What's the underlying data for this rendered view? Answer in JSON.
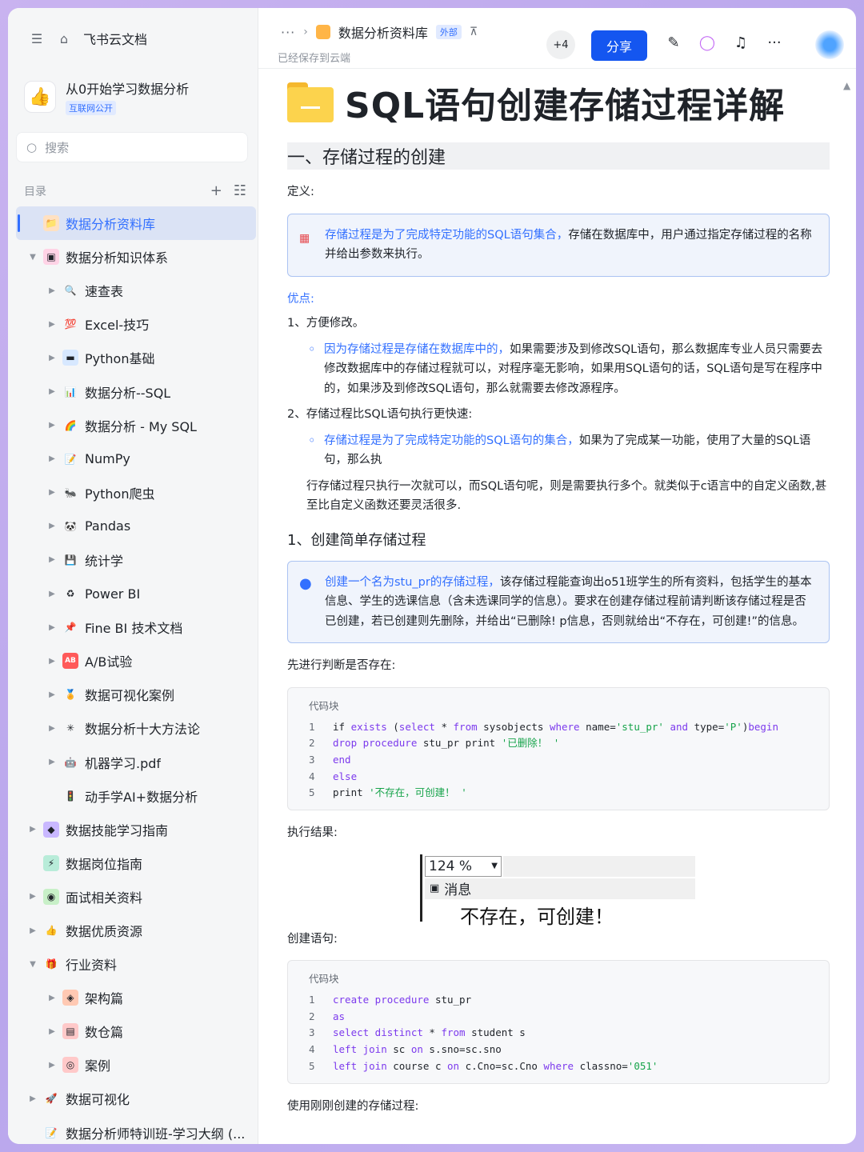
{
  "app": {
    "title": "飞书云文档"
  },
  "space": {
    "name": "从0开始学习数据分析",
    "badge": "互联网公开"
  },
  "search": {
    "placeholder": "搜索"
  },
  "toc": {
    "label": "目录"
  },
  "tree": [
    {
      "label": "数据分析资料库",
      "level": 0,
      "arrow": "",
      "icon": "📁",
      "icon_bg": "#ffe1c2",
      "active": true
    },
    {
      "label": "数据分析知识体系",
      "level": 0,
      "arrow": "▼",
      "icon": "▣",
      "icon_bg": "#ffd3e6"
    },
    {
      "label": "速查表",
      "level": 1,
      "arrow": "▶",
      "icon": "🔍",
      "icon_bg": "transparent"
    },
    {
      "label": "Excel-技巧",
      "level": 1,
      "arrow": "▶",
      "icon": "💯",
      "icon_bg": "transparent"
    },
    {
      "label": "Python基础",
      "level": 1,
      "arrow": "▶",
      "icon": "▬",
      "icon_bg": "#d7e8ff"
    },
    {
      "label": "数据分析--SQL",
      "level": 1,
      "arrow": "▶",
      "icon": "📊",
      "icon_bg": "transparent"
    },
    {
      "label": "数据分析 - My SQL",
      "level": 1,
      "arrow": "▶",
      "icon": "🌈",
      "icon_bg": "transparent"
    },
    {
      "label": "NumPy",
      "level": 1,
      "arrow": "▶",
      "icon": "📝",
      "icon_bg": "transparent"
    },
    {
      "label": "Python爬虫",
      "level": 1,
      "arrow": "▶",
      "icon": "🐜",
      "icon_bg": "transparent"
    },
    {
      "label": "Pandas",
      "level": 1,
      "arrow": "▶",
      "icon": "🐼",
      "icon_bg": "transparent"
    },
    {
      "label": "统计学",
      "level": 1,
      "arrow": "▶",
      "icon": "💾",
      "icon_bg": "transparent"
    },
    {
      "label": "Power BI",
      "level": 1,
      "arrow": "▶",
      "icon": "♻",
      "icon_bg": "transparent"
    },
    {
      "label": "Fine BI 技术文档",
      "level": 1,
      "arrow": "▶",
      "icon": "📌",
      "icon_bg": "transparent"
    },
    {
      "label": "A/B试验",
      "level": 1,
      "arrow": "▶",
      "icon": "AB",
      "icon_bg": "#ff5a5a"
    },
    {
      "label": "数据可视化案例",
      "level": 1,
      "arrow": "▶",
      "icon": "🏅",
      "icon_bg": "transparent"
    },
    {
      "label": "数据分析十大方法论",
      "level": 1,
      "arrow": "▶",
      "icon": "✳",
      "icon_bg": "transparent"
    },
    {
      "label": "机器学习.pdf",
      "level": 1,
      "arrow": "▶",
      "icon": "🤖",
      "icon_bg": "transparent"
    },
    {
      "label": "动手学AI+数据分析",
      "level": 1,
      "arrow": "",
      "icon": "🚦",
      "icon_bg": "transparent"
    },
    {
      "label": "数据技能学习指南",
      "level": 0,
      "arrow": "▶",
      "icon": "◆",
      "icon_bg": "#c9b8ff"
    },
    {
      "label": "数据岗位指南",
      "level": 0,
      "arrow": "",
      "icon": "⚡",
      "icon_bg": "#b8ecd9"
    },
    {
      "label": "面试相关资料",
      "level": 0,
      "arrow": "▶",
      "icon": "◉",
      "icon_bg": "#c8f0c8"
    },
    {
      "label": "数据优质资源",
      "level": 0,
      "arrow": "▶",
      "icon": "👍",
      "icon_bg": "transparent"
    },
    {
      "label": "行业资料",
      "level": 0,
      "arrow": "▼",
      "icon": "🎁",
      "icon_bg": "transparent"
    },
    {
      "label": "架构篇",
      "level": 1,
      "arrow": "▶",
      "icon": "◈",
      "icon_bg": "#ffc9b3"
    },
    {
      "label": "数仓篇",
      "level": 1,
      "arrow": "▶",
      "icon": "▤",
      "icon_bg": "#ffc9c9"
    },
    {
      "label": "案例",
      "level": 1,
      "arrow": "▶",
      "icon": "◎",
      "icon_bg": "#ffc9c9"
    },
    {
      "label": "数据可视化",
      "level": 0,
      "arrow": "▶",
      "icon": "🚀",
      "icon_bg": "transparent"
    },
    {
      "label": "数据分析师特训班-学习大纲 (...",
      "level": 0,
      "arrow": "",
      "icon": "📝",
      "icon_bg": "transparent"
    }
  ],
  "topbar": {
    "breadcrumb_more": "···",
    "breadcrumb_title": "数据分析资料库",
    "breadcrumb_badge": "外部",
    "saved": "已经保存到云端",
    "collaborators": "+4",
    "share": "分享"
  },
  "doc": {
    "title": "SQL语句创建存储过程详解",
    "h1": "一、存储过程的创建",
    "def_label": "定义:",
    "callout1_blue": "存储过程是为了完成特定功能的SQL语句集合，",
    "callout1_rest": "存储在数据库中，用户通过指定存储过程的名称并给出参数来执行。",
    "adv_label": "优点:",
    "adv1": "1、方便修改。",
    "adv1_blue": "因为存储过程是存储在数据库中的，",
    "adv1_rest": "如果需要涉及到修改SQL语句，那么数据库专业人员只需要去修改数据库中的存储过程就可以，对程序毫无影响，如果用SQL语句的话，SQL语句是写在程序中的，如果涉及到修改SQL语句，那么就需要去修改源程序。",
    "adv2": "2、存储过程比SQL语句执行更快速:",
    "adv2_blue": "存储过程是为了完成特定功能的SQL语句的集合，",
    "adv2_rest": "如果为了完成某一功能，使用了大量的SQL语句，那么执",
    "adv2_para": "行存储过程只执行一次就可以，而SQL语句呢，则是需要执行多个。就类似于c语言中的自定义函数,甚至比自定义函数还要灵活很多.",
    "h3": "1、创建简单存储过程",
    "callout2_blue": "创建一个名为stu_pr的存储过程，",
    "callout2_rest": "该存储过程能查询出o51班学生的所有资料，包括学生的基本信息、学生的选课信息（含未选课同学的信息）。要求在创建存储过程前请判断该存储过程是否已创建，若已创建则先删除，并给出“已删除! p信息，否则就给出“不存在，可创建!”的信息。",
    "check_label": "先进行判断是否存在:",
    "code_label": "代码块",
    "result_label": "执行结果:",
    "result_zoom": "124 %",
    "result_tab": "消息",
    "result_output": "不存在，可创建！",
    "create_label": "创建语句:",
    "use_label": "使用刚刚创建的存储过程:"
  },
  "code1": [
    {
      "n": "1",
      "html": "if <span class='kw'>exists</span> (<span class='kw'>select</span> * <span class='kw'>from</span> sysobjects <span class='kw'>where</span> name=<span class='str'>'stu_pr'</span> <span class='kw'>and</span> type=<span class='str'>'P'</span>)<span class='kw'>begin</span>"
    },
    {
      "n": "2",
      "html": "<span class='kw'>drop procedure</span> stu_pr print <span class='str'>'已删除！ '</span>"
    },
    {
      "n": "3",
      "html": "<span class='kw'>end</span>"
    },
    {
      "n": "4",
      "html": "<span class='kw'>else</span>"
    },
    {
      "n": "5",
      "html": "print <span class='str'>'不存在，可创建！ '</span>"
    }
  ],
  "code2": [
    {
      "n": "1",
      "html": "<span class='kw'>create procedure</span> stu_pr"
    },
    {
      "n": "2",
      "html": "<span class='kw'>as</span>"
    },
    {
      "n": "3",
      "html": "<span class='kw'>select distinct</span> * <span class='kw'>from</span> student s"
    },
    {
      "n": "4",
      "html": "<span class='kw'>left join</span> sc <span class='kw'>on</span> s.sno=sc.sno"
    },
    {
      "n": "5",
      "html": "<span class='kw'>left join</span> course c <span class='kw'>on</span> c.Cno=sc.Cno <span class='kw'>where</span> classno=<span class='str'>'051'</span>"
    }
  ],
  "colors": {
    "accent": "#3370ff",
    "share_bg": "#1456f0",
    "callout_border": "#abc3f2"
  }
}
